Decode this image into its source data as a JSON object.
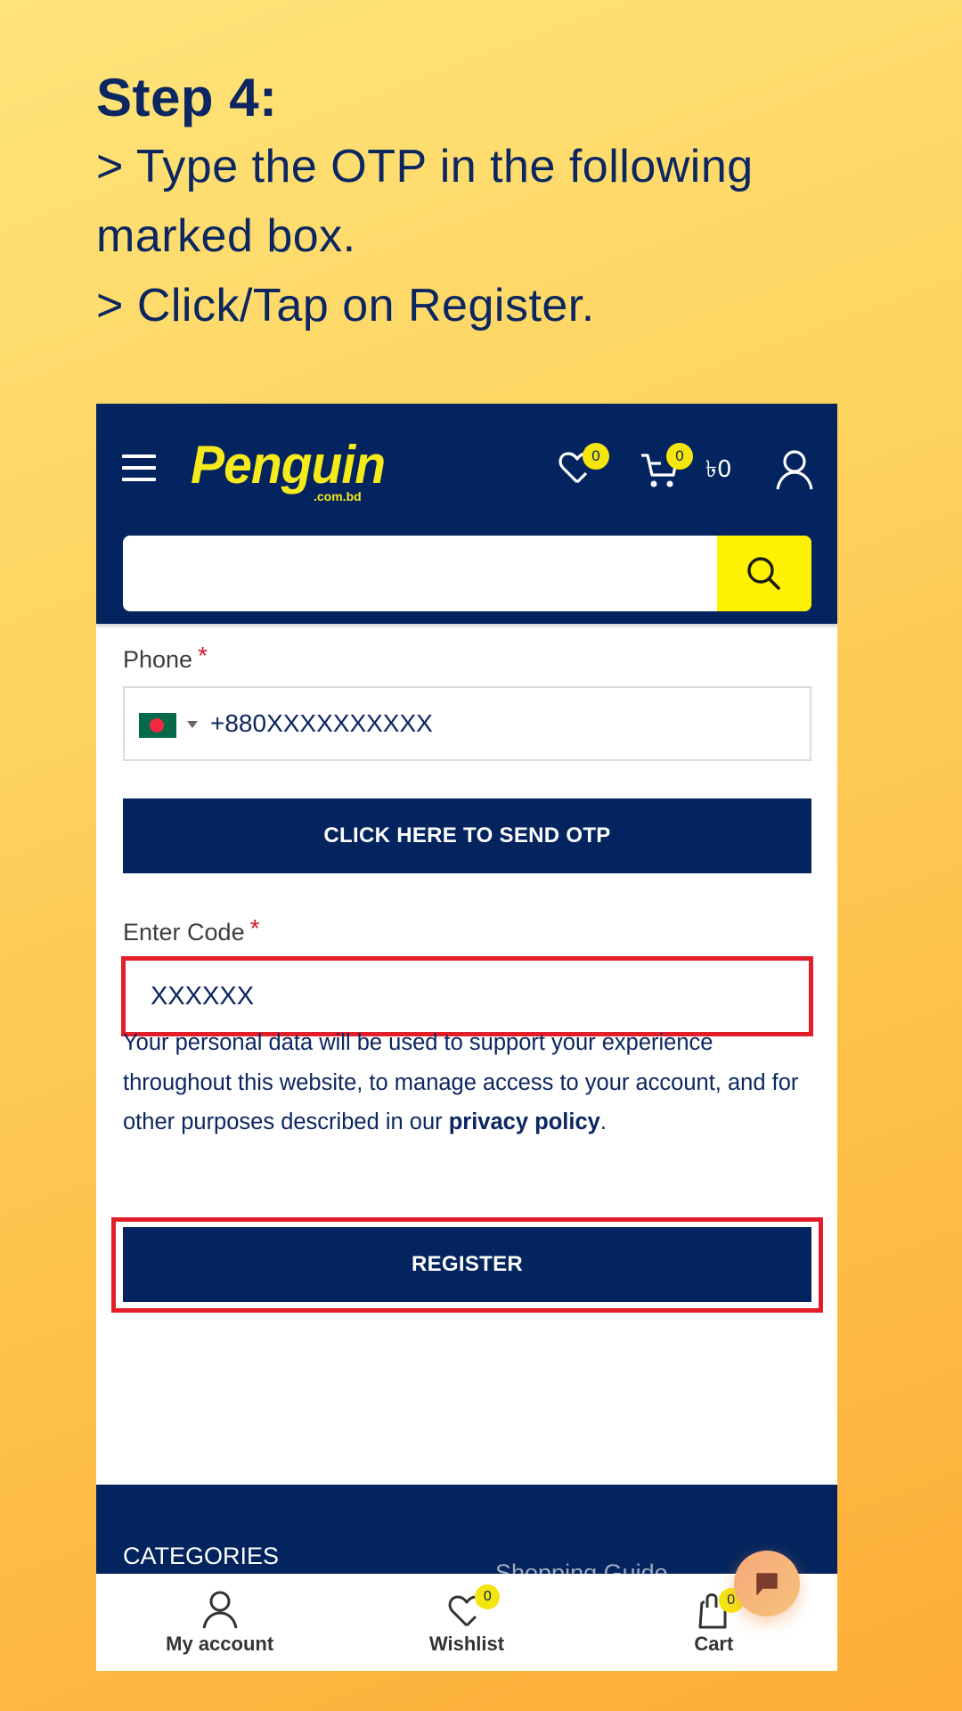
{
  "instructions": {
    "title": "Step 4:",
    "lines": [
      "> Type the OTP in the following",
      "marked box.",
      "> Click/Tap on Register."
    ]
  },
  "header": {
    "logo_text": "Penguin",
    "logo_subtext": ".com.bd",
    "wishlist_count": "0",
    "cart_count": "0",
    "cart_total": "৳0",
    "search_placeholder": ""
  },
  "form": {
    "phone_label": "Phone",
    "required_mark": "*",
    "country_flag": "bangladesh-flag",
    "phone_value": "+880XXXXXXXXXX",
    "send_otp_label": "CLICK HERE TO SEND OTP",
    "code_label": "Enter Code",
    "code_value": "XXXXXX",
    "privacy_text": "Your personal data will be used to support your experience throughout this website, to manage access to your account, and for other purposes described in our ",
    "privacy_link": "privacy policy",
    "privacy_end": ".",
    "register_label": "REGISTER"
  },
  "highlight_color": "#e31e2b",
  "brand_color": "#03245e",
  "accent_color": "#fff200",
  "footer": {
    "categories_heading": "CATEGORIES",
    "partially_hidden_text": "Shopping Guide"
  },
  "bottom_nav": {
    "items": [
      {
        "label": "My account",
        "icon": "user-icon"
      },
      {
        "label": "Wishlist",
        "icon": "heart-icon",
        "badge": "0"
      },
      {
        "label": "Cart",
        "icon": "shopping-bag-icon",
        "badge": "0"
      }
    ]
  }
}
